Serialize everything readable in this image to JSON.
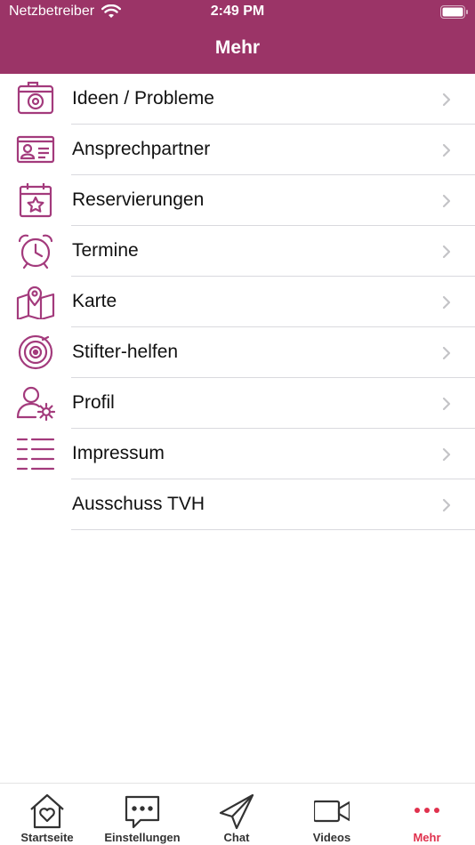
{
  "status_bar": {
    "carrier": "Netzbetreiber",
    "time": "2:49 PM"
  },
  "nav": {
    "title": "Mehr"
  },
  "colors": {
    "header": "#9b3467",
    "icon": "#a33a7c",
    "active_tab": "#e0314d"
  },
  "menu_items": [
    {
      "label": "Ideen / Probleme",
      "icon": "camera-icon"
    },
    {
      "label": "Ansprechpartner",
      "icon": "contact-card-icon"
    },
    {
      "label": "Reservierungen",
      "icon": "calendar-star-icon"
    },
    {
      "label": "Termine",
      "icon": "alarm-clock-icon"
    },
    {
      "label": "Karte",
      "icon": "map-pin-icon"
    },
    {
      "label": "Stifter-helfen",
      "icon": "target-icon"
    },
    {
      "label": "Profil",
      "icon": "user-gear-icon"
    },
    {
      "label": "Impressum",
      "icon": "list-icon"
    },
    {
      "label": "Ausschuss TVH",
      "icon": ""
    }
  ],
  "tabs": [
    {
      "label": "Startseite",
      "icon": "home-heart-icon"
    },
    {
      "label": "Einstellungen",
      "icon": "chat-bubble-icon"
    },
    {
      "label": "Chat",
      "icon": "paper-plane-icon"
    },
    {
      "label": "Videos",
      "icon": "video-camera-icon"
    },
    {
      "label": "Mehr",
      "icon": "more-dots-icon",
      "active": true
    }
  ]
}
